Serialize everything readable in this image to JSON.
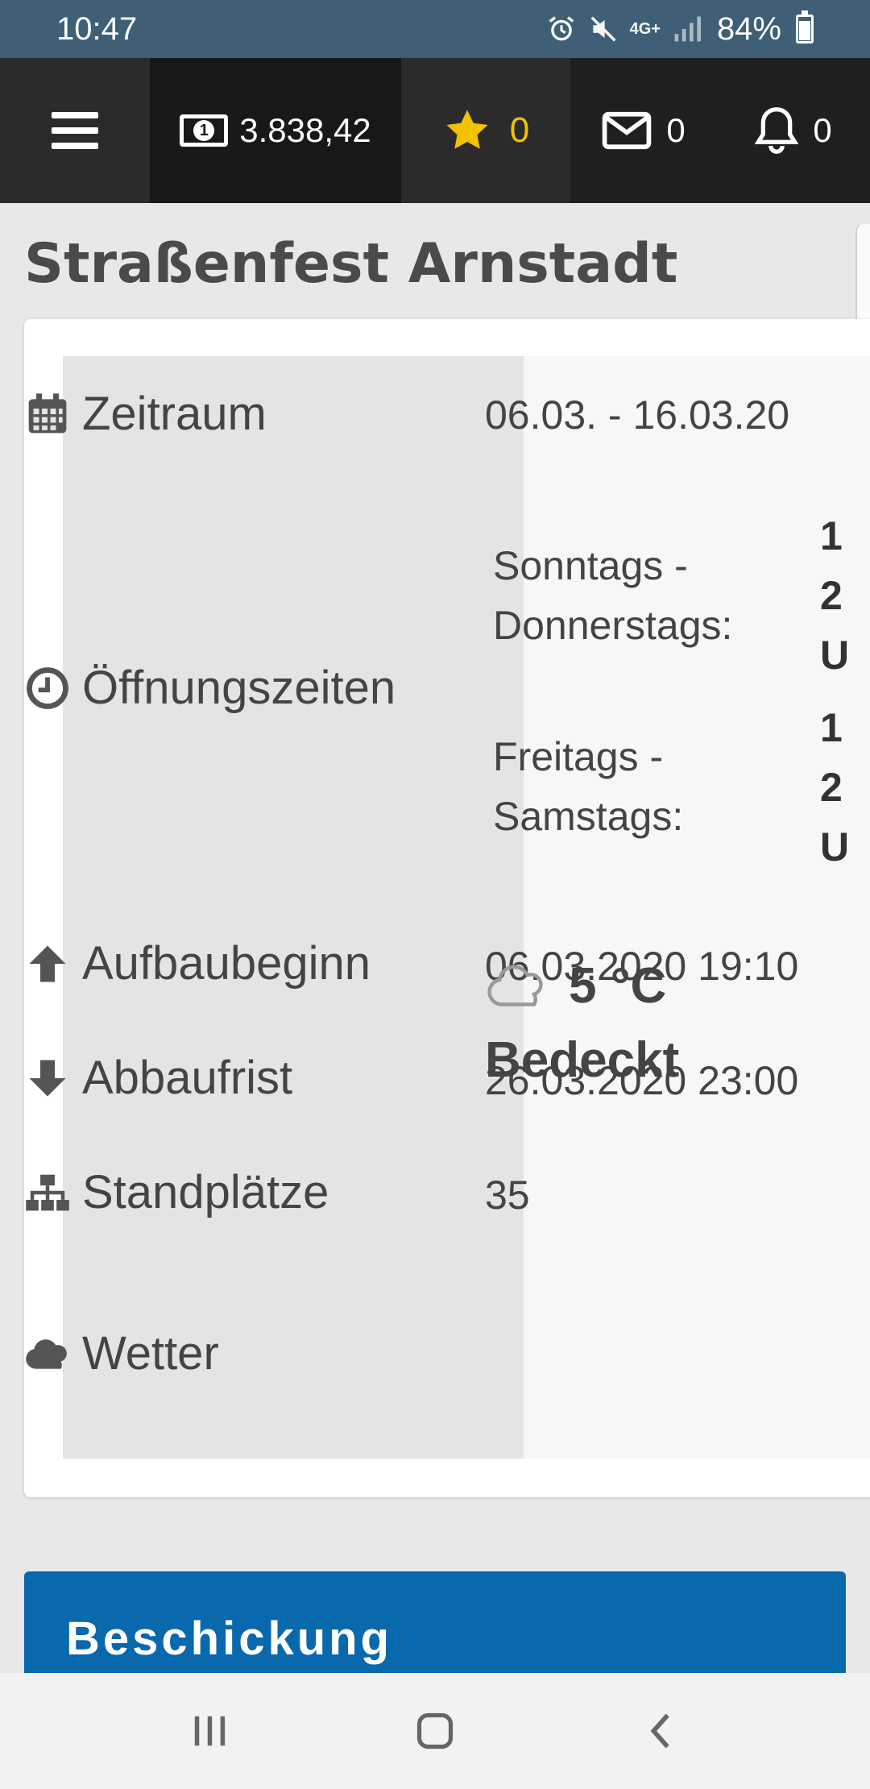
{
  "status_bar": {
    "time": "10:47",
    "battery": "84%",
    "network": "4G+"
  },
  "top_bar": {
    "balance": "3.838,42",
    "stars": "0",
    "messages": "0",
    "notifications": "0",
    "icons": [
      "menu-icon",
      "money-icon",
      "star-icon",
      "mail-icon",
      "bell-icon"
    ]
  },
  "page": {
    "title": "Straßenfest Arnstadt"
  },
  "details": {
    "period_label": "Zeitraum",
    "period_value": "06.03. - 16.03.20",
    "opening_label": "Öffnungszeiten",
    "opening_groups": [
      {
        "days_line1": "Sonntags -",
        "days_line2": "Donnerstags:",
        "time_lines": [
          "1",
          "2",
          "U"
        ]
      },
      {
        "days_line1": "Freitags -",
        "days_line2": "Samstags:",
        "time_lines": [
          "1",
          "2",
          "U"
        ]
      }
    ],
    "setup_label": "Aufbaubeginn",
    "setup_value": "06.03.2020 19:10",
    "teardown_label": "Abbaufrist",
    "teardown_value": "26.03.2020 23:00",
    "stands_label": "Standplätze",
    "stands_value": "35",
    "weather_label": "Wetter",
    "weather_temp": "5 °C",
    "weather_desc": "Bedeckt"
  },
  "section": {
    "title": "Beschickung"
  },
  "colors": {
    "status_bar": "#3e5f75",
    "top_bar": "#1f1f1f",
    "star": "#f2c200",
    "section_blue": "#0a68ad"
  }
}
